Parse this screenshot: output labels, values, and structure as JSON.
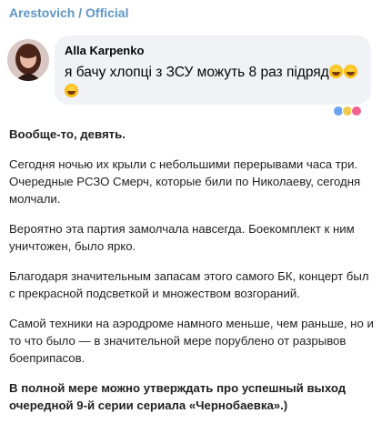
{
  "channel": {
    "title": "Arestovich / Official"
  },
  "quote": {
    "author": "Alla Karpenko",
    "text": "я бачу хлопці з ЗСУ можуть 8 раз підряд",
    "emojis": [
      "laughing-crying-emoji",
      "laughing-crying-emoji",
      "laughing-crying-emoji"
    ]
  },
  "post": {
    "paragraphs": [
      {
        "text": "Вообще-то, девять.",
        "bold": true
      },
      {
        "text": "Сегодня ночью их крыли с небольшими перерывами часа три. Очередные РСЗО Смерч, которые били по Николаеву, сегодня молчали.",
        "bold": false
      },
      {
        "text": "Вероятно эта партия замолчала навсегда. Боекомплект к ним уничтожен, было ярко.",
        "bold": false
      },
      {
        "text": "Благодаря значительным запасам этого самого БК, концерт был с прекрасной подсветкой и множеством возгораний.",
        "bold": false
      },
      {
        "text": "Самой техники на аэродроме намного меньше, чем раньше, но и то что было — в значительной мере порублено от разрывов боеприпасов.",
        "bold": false
      },
      {
        "text": "В полной мере можно утверждать про успешный выход очередной 9-й серии сериала «Чернобаевка».)",
        "bold": true
      }
    ]
  }
}
